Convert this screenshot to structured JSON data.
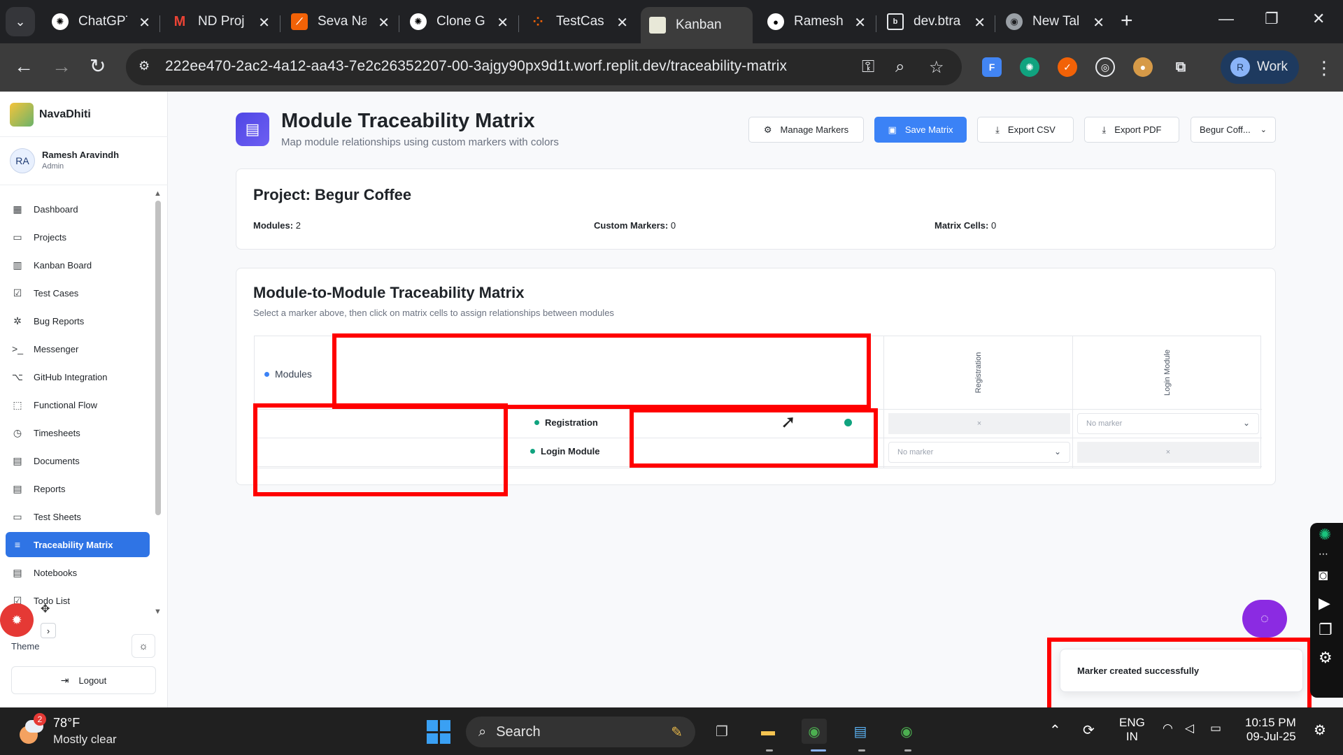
{
  "browser": {
    "tabs": [
      {
        "title": "ChatGPT",
        "favicon": "chatgpt-icon",
        "color": "#ffffff"
      },
      {
        "title": "ND Proj",
        "favicon": "gmail-icon",
        "color": "#ea4335"
      },
      {
        "title": "Seva Na",
        "favicon": "replit-icon",
        "color": "#f26207"
      },
      {
        "title": "Clone G",
        "favicon": "chatgpt-icon",
        "color": "#ffffff"
      },
      {
        "title": "TestCas",
        "favicon": "replit-icon",
        "color": "#f26207"
      },
      {
        "title": "Kanban",
        "favicon": "navadhiti-icon",
        "color": "#6bb36a"
      },
      {
        "title": "Ramesh",
        "favicon": "github-icon",
        "color": "#ffffff"
      },
      {
        "title": "dev.btra",
        "favicon": "page-icon",
        "color": "#ffffff"
      },
      {
        "title": "New Tal",
        "favicon": "chrome-icon",
        "color": "#9aa0a6"
      }
    ],
    "active_tab": 5,
    "url": "222ee470-2ac2-4a12-aa43-7e2c26352207-00-3ajgy90px9d1t.worf.replit.dev/traceability-matrix",
    "profile_initial": "R",
    "profile_label": "Work"
  },
  "sidebar": {
    "brand": "NavaDhiti",
    "user": {
      "initials": "RA",
      "name": "Ramesh Aravindh",
      "role": "Admin"
    },
    "items": [
      {
        "label": "Dashboard",
        "icon": "grid-icon"
      },
      {
        "label": "Projects",
        "icon": "folder-icon"
      },
      {
        "label": "Kanban Board",
        "icon": "kanban-icon"
      },
      {
        "label": "Test Cases",
        "icon": "checkbox-icon"
      },
      {
        "label": "Bug Reports",
        "icon": "bug-icon"
      },
      {
        "label": "Messenger",
        "icon": "terminal-icon"
      },
      {
        "label": "GitHub Integration",
        "icon": "github-icon"
      },
      {
        "label": "Functional Flow",
        "icon": "flow-icon"
      },
      {
        "label": "Timesheets",
        "icon": "clock-icon"
      },
      {
        "label": "Documents",
        "icon": "document-icon"
      },
      {
        "label": "Reports",
        "icon": "report-icon"
      },
      {
        "label": "Test Sheets",
        "icon": "sheet-icon"
      },
      {
        "label": "Traceability Matrix",
        "icon": "filter-icon",
        "active": true
      },
      {
        "label": "Notebooks",
        "icon": "notebook-icon"
      },
      {
        "label": "Todo List",
        "icon": "todo-icon"
      }
    ],
    "theme_label": "Theme",
    "logout_label": "Logout"
  },
  "header": {
    "title": "Module Traceability Matrix",
    "subtitle": "Map module relationships using custom markers with colors",
    "buttons": {
      "manage": "Manage Markers",
      "save": "Save Matrix",
      "csv": "Export CSV",
      "pdf": "Export PDF"
    },
    "project_select": "Begur Coff..."
  },
  "project": {
    "title": "Project: Begur Coffee",
    "stats": [
      {
        "label": "Modules:",
        "value": "2"
      },
      {
        "label": "Custom Markers:",
        "value": "0"
      },
      {
        "label": "Matrix Cells:",
        "value": "0"
      }
    ]
  },
  "matrix": {
    "title": "Module-to-Module Traceability Matrix",
    "subtitle": "Select a marker above, then click on matrix cells to assign relationships between modules",
    "corner_label": "Modules",
    "corner_dot_color": "#3b82f6",
    "columns": [
      "Registration",
      "Login Module"
    ],
    "rows": [
      {
        "label": "Registration",
        "dot_color": "#10a37f",
        "cells": [
          "×",
          "No marker"
        ]
      },
      {
        "label": "Login Module",
        "dot_color": "#10a37f",
        "cells": [
          "No marker",
          "×"
        ]
      }
    ]
  },
  "toast": {
    "message": "Marker created successfully"
  },
  "annotations": {
    "highlight_color": "#ff0000"
  },
  "taskbar": {
    "weather_badge": "2",
    "temperature": "78°F",
    "condition": "Mostly clear",
    "search_placeholder": "Search",
    "lang_top": "ENG",
    "lang_bottom": "IN",
    "time": "10:15 PM",
    "date": "09-Jul-25"
  }
}
